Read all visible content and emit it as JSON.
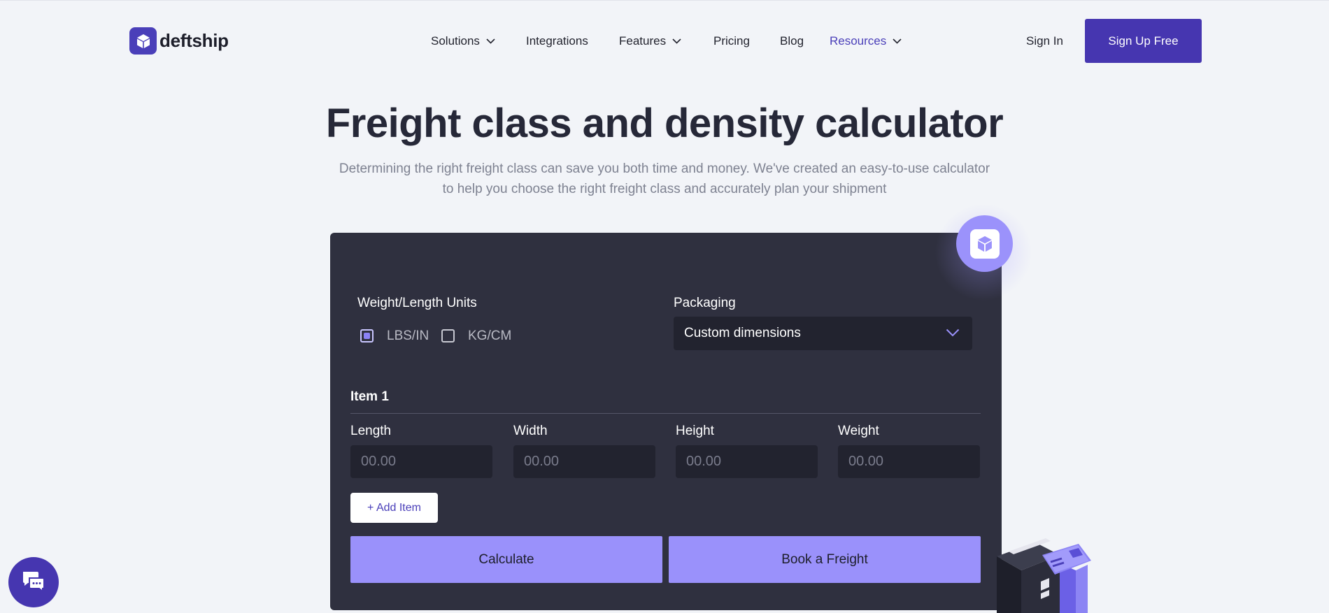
{
  "header": {
    "logo_text": "deftship",
    "nav": [
      {
        "label": "Solutions",
        "dropdown": true
      },
      {
        "label": "Integrations",
        "dropdown": false
      },
      {
        "label": "Features",
        "dropdown": true
      },
      {
        "label": "Pricing",
        "dropdown": false
      },
      {
        "label": "Blog",
        "dropdown": false
      },
      {
        "label": "Resources",
        "dropdown": true,
        "active": true
      }
    ],
    "sign_in": "Sign In",
    "sign_up": "Sign Up Free"
  },
  "hero": {
    "title": "Freight class and density calculator",
    "subtitle_line1": "Determining the right freight class can save you both time and money. We've created an easy-to-use calculator",
    "subtitle_line2": "to help you choose the right freight class and accurately plan your shipment"
  },
  "calculator": {
    "units_label": "Weight/Length Units",
    "unit_options": [
      {
        "label": "LBS/IN",
        "checked": true
      },
      {
        "label": "KG/CM",
        "checked": false
      }
    ],
    "packaging_label": "Packaging",
    "packaging_value": "Custom dimensions",
    "item_title": "Item 1",
    "fields": [
      {
        "label": "Length",
        "placeholder": "00.00"
      },
      {
        "label": "Width",
        "placeholder": "00.00"
      },
      {
        "label": "Height",
        "placeholder": "00.00"
      },
      {
        "label": "Weight",
        "placeholder": "00.00"
      }
    ],
    "add_item": "+ Add Item",
    "calculate": "Calculate",
    "book_freight": "Book a Freight"
  },
  "icons": {
    "logo": "cube-icon",
    "badge": "cube-icon",
    "chat": "chat-icon",
    "dropdown": "chevron-down-icon"
  },
  "colors": {
    "brand": "#4636b0",
    "accent": "#9a91fb",
    "card_bg": "#2f303f",
    "page_bg": "#f2f4f8"
  }
}
